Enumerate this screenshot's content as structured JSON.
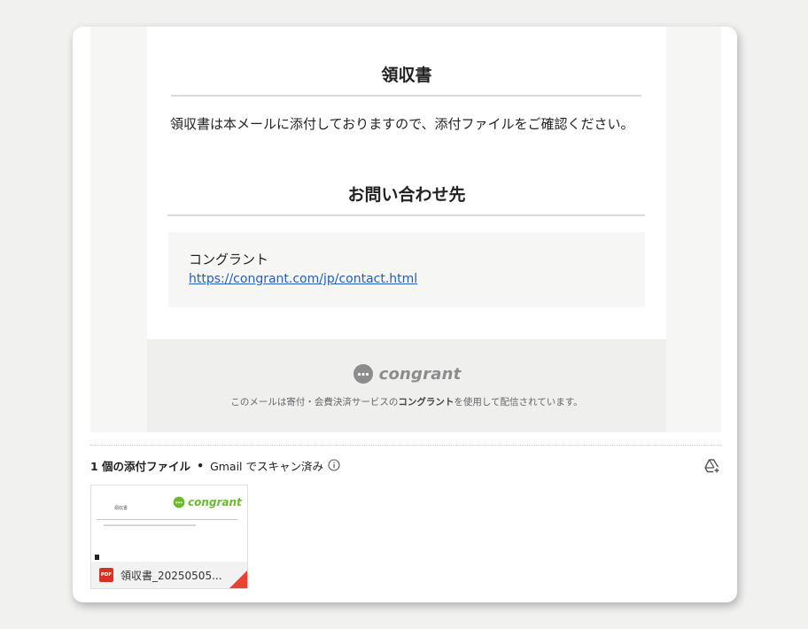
{
  "email": {
    "receipt_title": "領収書",
    "receipt_text": "領収書は本メールに添付しておりますので、添付ファイルをご確認ください。",
    "contact_title": "お問い合わせ先",
    "contact_name": "コングラント",
    "contact_link": "https://congrant.com/jp/contact.html",
    "footer_logo_text": "congrant",
    "footer_note_before": "このメールは寄付・会費決済サービスの",
    "footer_note_bold": "コングラント",
    "footer_note_after": "を使用して配信されています。"
  },
  "attachments": {
    "count_label": "1 個の添付ファイル",
    "separator": "•",
    "scan_label": "Gmail でスキャン済み",
    "icons": [
      "info-icon",
      "add-to-drive-icon"
    ],
    "file": {
      "name": "領収書_20250505...",
      "type_label": "PDF",
      "preview_label": "領収書",
      "preview_logo_text": "congrant"
    }
  },
  "colors": {
    "link": "#1f5fbf",
    "pdf_red": "#d93025",
    "brand_green": "#6cbb2c",
    "footer_logo_gray": "#8c8c8c"
  }
}
